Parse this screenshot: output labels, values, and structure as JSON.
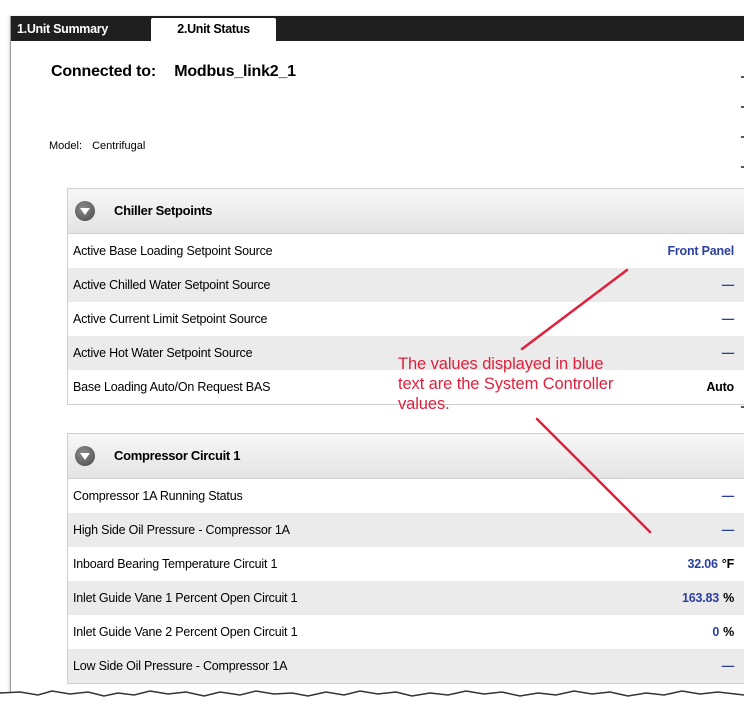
{
  "tabs": [
    {
      "label": "1.Unit Summary",
      "active": false
    },
    {
      "label": "2.Unit Status",
      "active": true
    }
  ],
  "connection": {
    "label": "Connected to:",
    "value": "Modbus_link2_1"
  },
  "model": {
    "label": "Model:",
    "value": "Centrifugal"
  },
  "panels": [
    {
      "title": "Chiller Setpoints",
      "icon": "collapse-icon",
      "rows": [
        {
          "label": "Active Base Loading Setpoint Source",
          "value": "Front Panel"
        },
        {
          "label": "Active Chilled Water Setpoint Source",
          "value": "—"
        },
        {
          "label": "Active Current Limit Setpoint Source",
          "value": "—"
        },
        {
          "label": "Active Hot Water Setpoint Source",
          "value": "—"
        },
        {
          "label": "Base Loading Auto/On Request BAS",
          "value": "Auto"
        }
      ]
    },
    {
      "title": "Compressor Circuit 1",
      "icon": "collapse-icon",
      "rows": [
        {
          "label": "Compressor 1A Running Status",
          "value": "—"
        },
        {
          "label": "High Side Oil Pressure - Compressor 1A",
          "value": "—"
        },
        {
          "label": "Inboard Bearing Temperature Circuit 1",
          "value": "32.06",
          "unit": "°F"
        },
        {
          "label": "Inlet Guide Vane 1 Percent Open Circuit 1",
          "value": "163.83",
          "unit": "%"
        },
        {
          "label": "Inlet Guide Vane 2 Percent Open Circuit 1",
          "value": "0",
          "unit": "%"
        },
        {
          "label": "Low Side Oil Pressure - Compressor 1A",
          "value": "—"
        }
      ]
    }
  ],
  "callout": {
    "line1": "The values displayed in blue",
    "line2": "text are the System  Controller",
    "line3": "values.",
    "color": "#e0203c"
  },
  "colors": {
    "system_controller_value": "#2b3fa0",
    "tab_bar": "#1f1f1f",
    "row_alt": "#ebebeb"
  }
}
